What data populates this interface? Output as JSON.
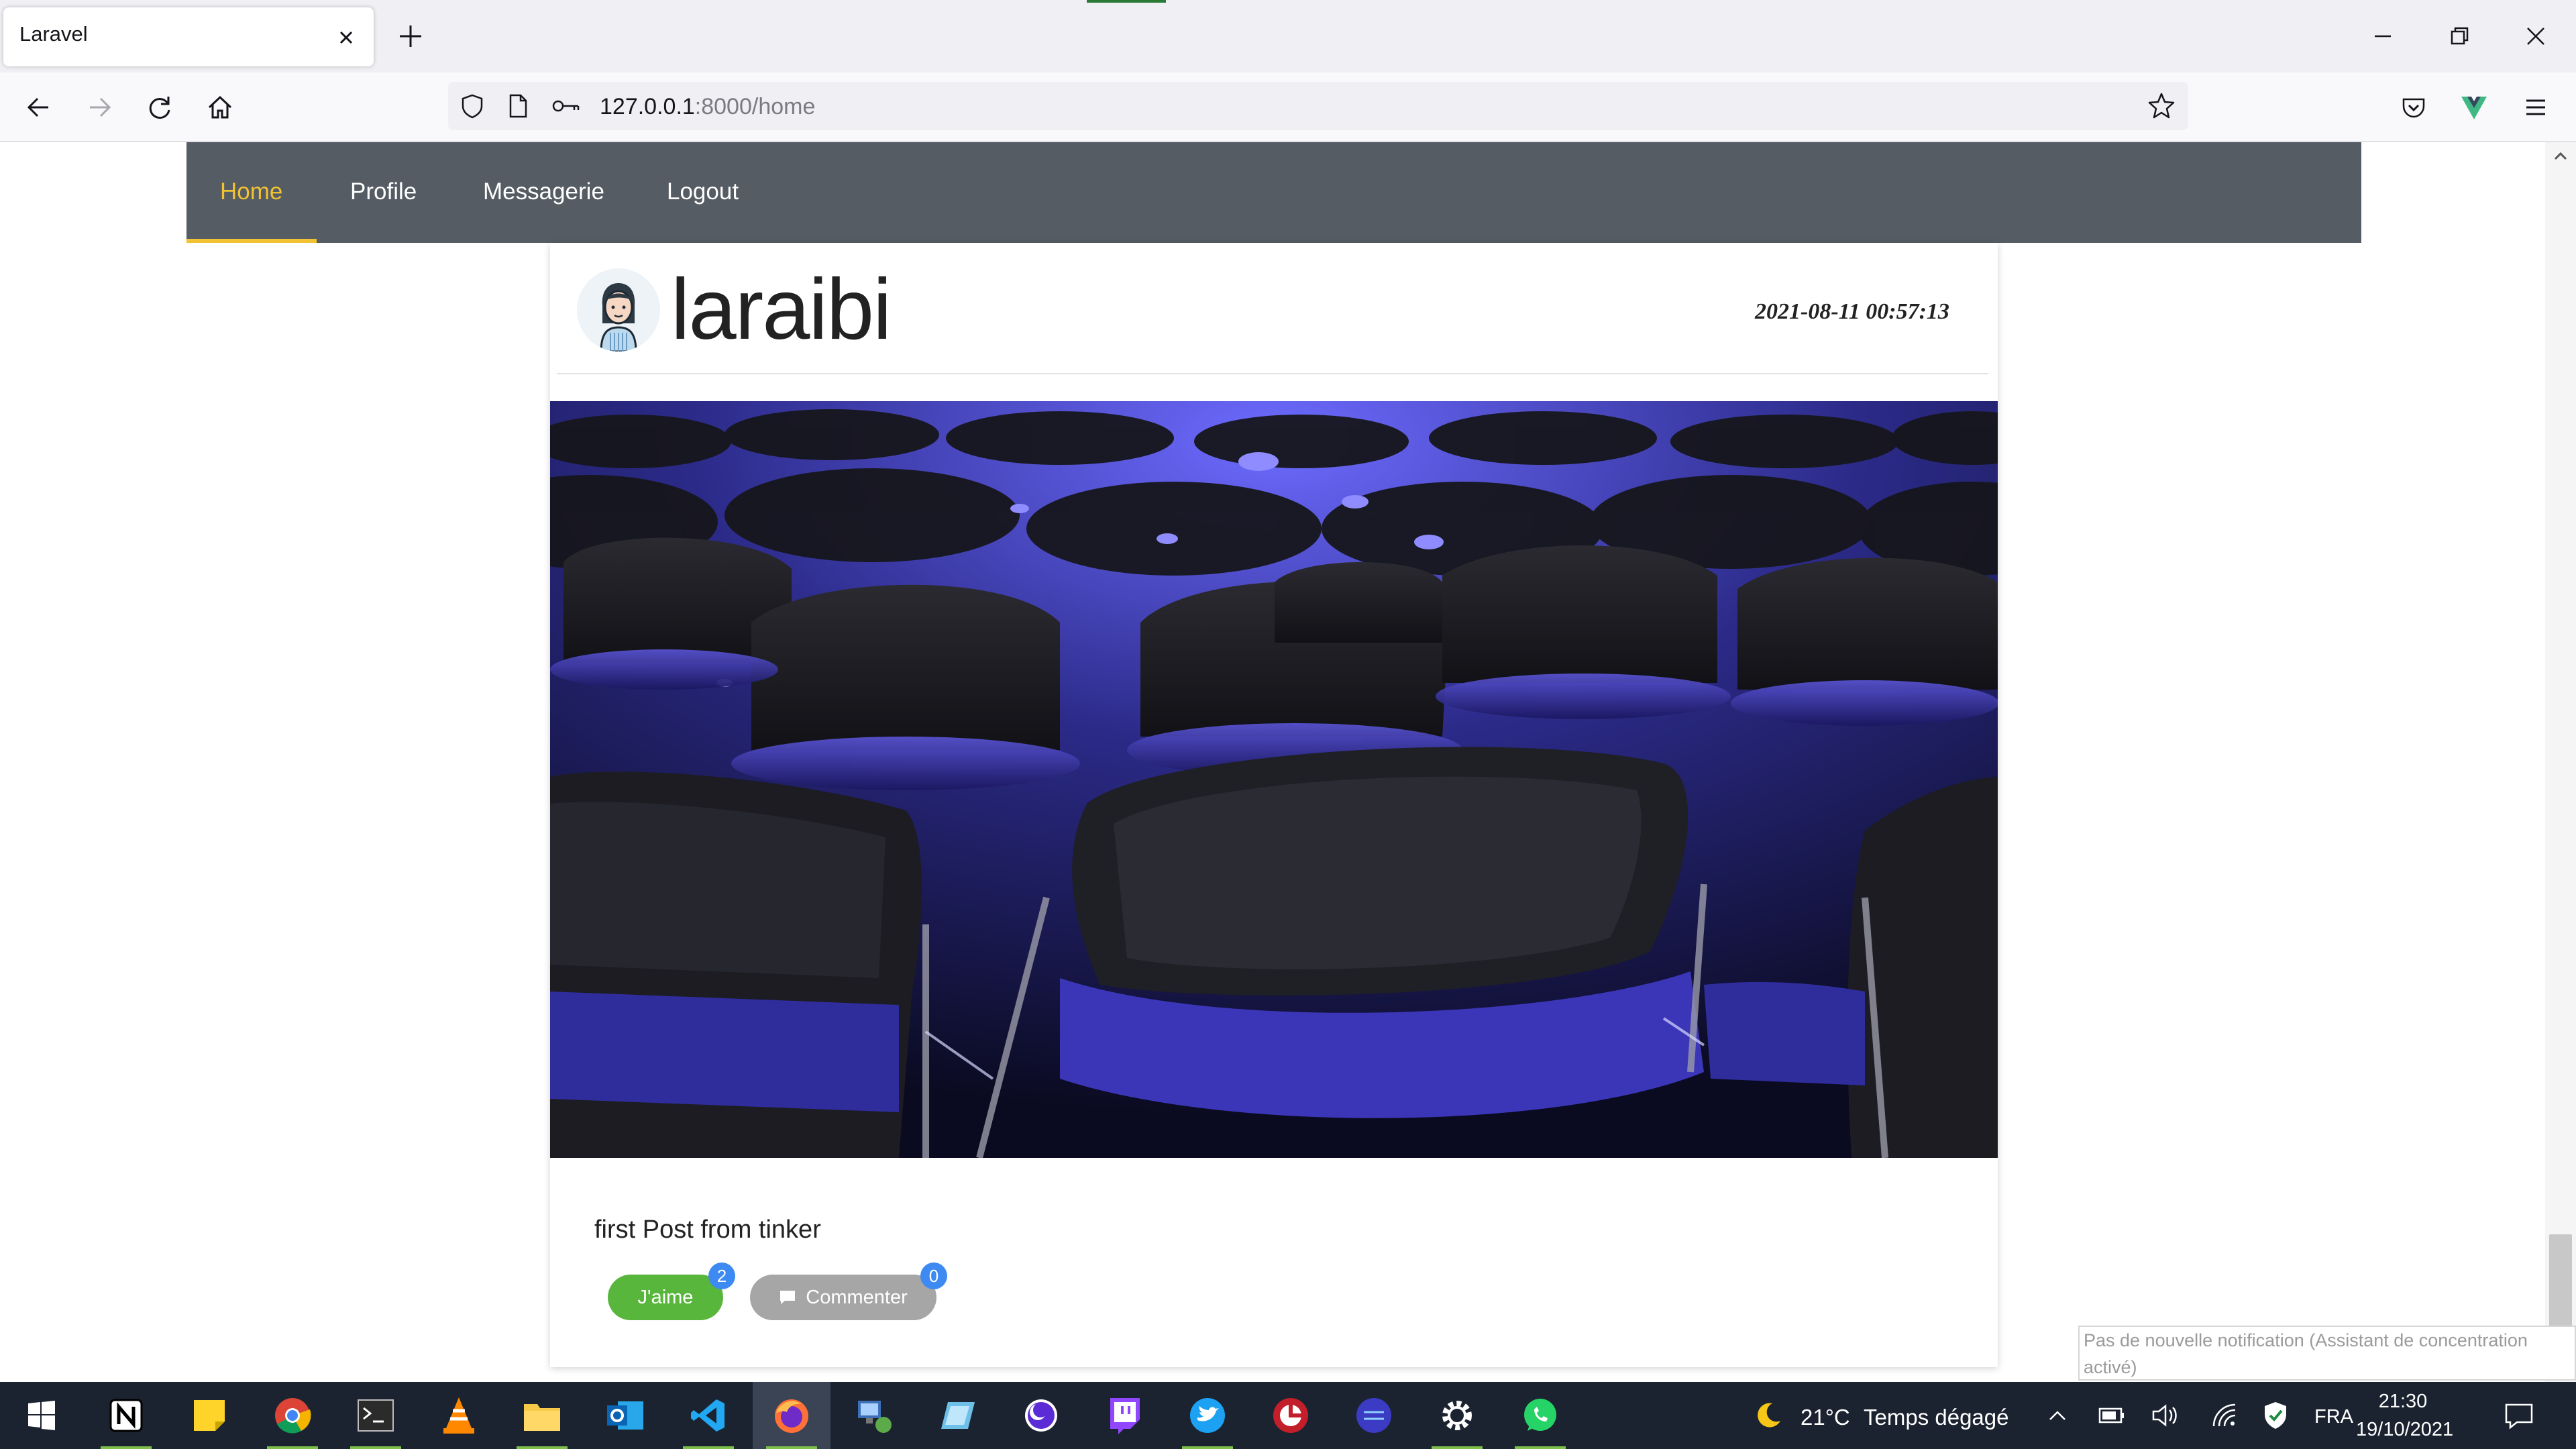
{
  "browser": {
    "tab_title": "Laravel",
    "url_host": "127.0.0.1",
    "url_path": ":8000/home"
  },
  "app_nav": {
    "items": [
      {
        "label": "Home",
        "active": true
      },
      {
        "label": "Profile",
        "active": false
      },
      {
        "label": "Messagerie",
        "active": false
      },
      {
        "label": "Logout",
        "active": false
      }
    ]
  },
  "post": {
    "username": "laraibi",
    "date": "2021-08-11 00:57:13",
    "text": "first Post from tinker",
    "like_label": "J'aime",
    "like_count": "2",
    "comment_label": "Commenter",
    "comment_count": "0"
  },
  "notification": "Pas de nouvelle notification (Assistant de concentration activé)",
  "taskbar": {
    "weather_temp": "21°C",
    "weather_desc": "Temps dégagé",
    "language": "FRA",
    "time": "21:30",
    "date": "19/10/2021"
  },
  "colors": {
    "nav_bg": "#555c63",
    "nav_active": "#f1c232",
    "like_button": "#58b63c",
    "comment_button": "#a6a6a6",
    "badge": "#3d8bf2",
    "taskbar_bg": "#1b2330"
  }
}
